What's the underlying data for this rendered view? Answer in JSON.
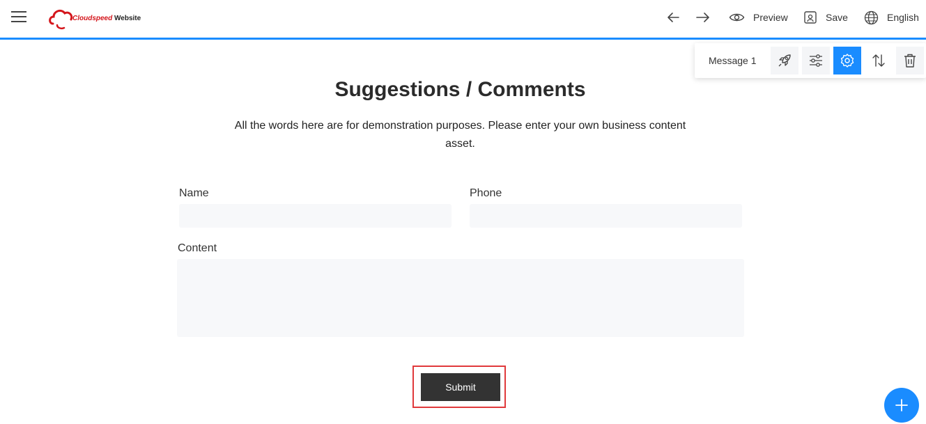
{
  "topbar": {
    "logo": {
      "brand_red": "Cloudspeed",
      "brand_dark": "Website"
    },
    "preview_label": "Preview",
    "save_label": "Save",
    "language_label": "English"
  },
  "floating_toolbar": {
    "section_label": "Message 1",
    "buttons": [
      "rocket-icon",
      "sliders-icon",
      "gear-icon",
      "sort-icon",
      "trash-icon"
    ],
    "active_button": "gear-icon"
  },
  "form": {
    "title": "Suggestions / Comments",
    "description": "All the words here are for demonstration purposes. Please enter your own business content asset.",
    "name_label": "Name",
    "name_value": "",
    "phone_label": "Phone",
    "phone_value": "",
    "content_label": "Content",
    "content_value": "",
    "submit_label": "Submit"
  },
  "colors": {
    "accent": "#1a8cff",
    "submit_bg": "#333333",
    "highlight": "#e0393b",
    "brand_red": "#d4161c"
  }
}
